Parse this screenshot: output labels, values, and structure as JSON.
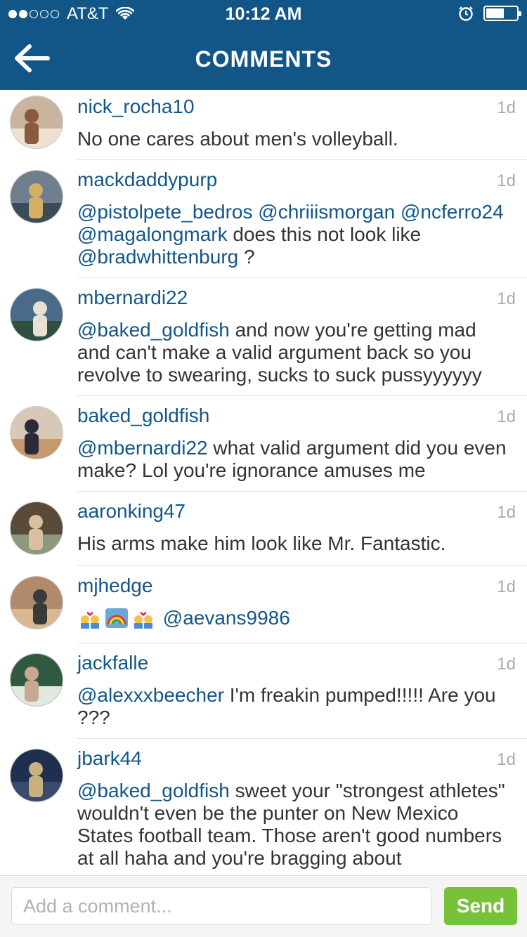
{
  "status_bar": {
    "carrier": "AT&T",
    "time": "10:12 AM",
    "signal_bars": 2,
    "signal_total": 5,
    "battery_level": 0.55
  },
  "nav": {
    "title": "COMMENTS",
    "back_icon": "back-arrow-icon"
  },
  "comments": [
    {
      "username": "nick_rocha10",
      "age": "1d",
      "avatar_colors": [
        "#c9b4a0",
        "#8b5a3c",
        "#f0e0d0"
      ],
      "parts": [
        {
          "t": "No one cares about men's volleyball."
        }
      ]
    },
    {
      "username": "mackdaddypurp",
      "age": "1d",
      "avatar_colors": [
        "#6f7f8f",
        "#d4b064",
        "#3c4b5a"
      ],
      "parts": [
        {
          "t": "@pistolpete_bedros",
          "m": true
        },
        {
          "t": " "
        },
        {
          "t": "@chriiismorgan",
          "m": true
        },
        {
          "t": " "
        },
        {
          "t": "@ncferro24",
          "m": true
        },
        {
          "t": " "
        },
        {
          "t": "@magalongmark",
          "m": true
        },
        {
          "t": " does this not look like "
        },
        {
          "t": "@bradwhittenburg",
          "m": true
        },
        {
          "t": " ?"
        }
      ]
    },
    {
      "username": "mbernardi22",
      "age": "1d",
      "avatar_colors": [
        "#4a6a8a",
        "#e8e0d0",
        "#2f4f3f"
      ],
      "parts": [
        {
          "t": "@baked_goldfish",
          "m": true
        },
        {
          "t": " and now you're getting mad and can't make a valid argument back so you revolve to swearing, sucks to suck pussyyyyyy"
        }
      ]
    },
    {
      "username": "baked_goldfish",
      "age": "1d",
      "avatar_colors": [
        "#d8c8b8",
        "#2a2a3a",
        "#c49a6c"
      ],
      "parts": [
        {
          "t": "@mbernardi22",
          "m": true
        },
        {
          "t": " what valid argument did you even make? Lol you're ignorance amuses me"
        }
      ]
    },
    {
      "username": "aaronking47",
      "age": "1d",
      "avatar_colors": [
        "#5a4a3a",
        "#d8c0a0",
        "#8a9a7a"
      ],
      "parts": [
        {
          "t": "His arms make him look like Mr. Fantastic."
        }
      ]
    },
    {
      "username": "mjhedge",
      "age": "1d",
      "avatar_colors": [
        "#b08a6a",
        "#3a3a3a",
        "#d8b890"
      ],
      "parts": [
        {
          "e": "couple-heart-icon"
        },
        {
          "e": "rainbow-icon"
        },
        {
          "e": "couple-heart-icon"
        },
        {
          "t": " "
        },
        {
          "t": "@aevans9986",
          "m": true
        }
      ]
    },
    {
      "username": "jackfalle",
      "age": "1d",
      "avatar_colors": [
        "#2f5a3f",
        "#c8a890",
        "#e0e8e0"
      ],
      "parts": [
        {
          "t": "@alexxxbeecher",
          "m": true
        },
        {
          "t": " I'm freakin pumped!!!!! Are you ???"
        }
      ]
    },
    {
      "username": "jbark44",
      "age": "1d",
      "avatar_colors": [
        "#1f2f4f",
        "#c8b080",
        "#3a4a6a"
      ],
      "parts": [
        {
          "t": "@baked_goldfish",
          "m": true
        },
        {
          "t": " sweet your \"strongest athletes\" wouldn't even be the punter on New Mexico States football team. Those aren't good numbers at all haha and you're bragging about"
        }
      ]
    }
  ],
  "composer": {
    "placeholder": "Add a comment...",
    "send_label": "Send"
  },
  "colors": {
    "header": "#125688",
    "link": "#125688",
    "send": "#78c23b"
  }
}
